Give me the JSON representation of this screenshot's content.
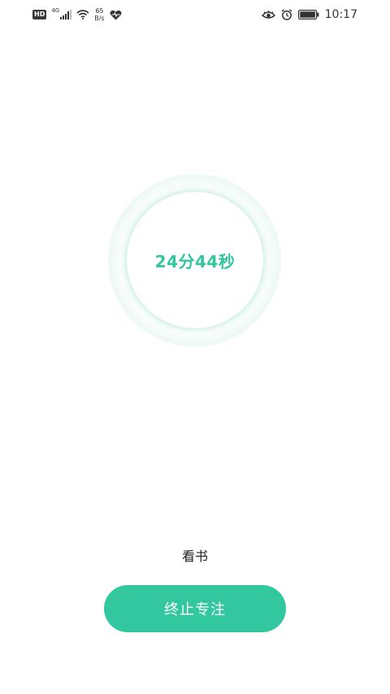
{
  "status_bar": {
    "hd_label": "HD",
    "network_type": "4G",
    "speed_value": "65",
    "speed_unit": "B/s",
    "time": "10:17",
    "icons": [
      "signal-icon",
      "wifi-icon",
      "health-heart-icon",
      "eye-icon",
      "alarm-icon",
      "battery-icon"
    ]
  },
  "timer": {
    "display": "24分44秒",
    "accent_color": "#33c4a0"
  },
  "task": {
    "label": "看书"
  },
  "actions": {
    "stop_label": "终止专注",
    "button_color": "#33c79f"
  }
}
